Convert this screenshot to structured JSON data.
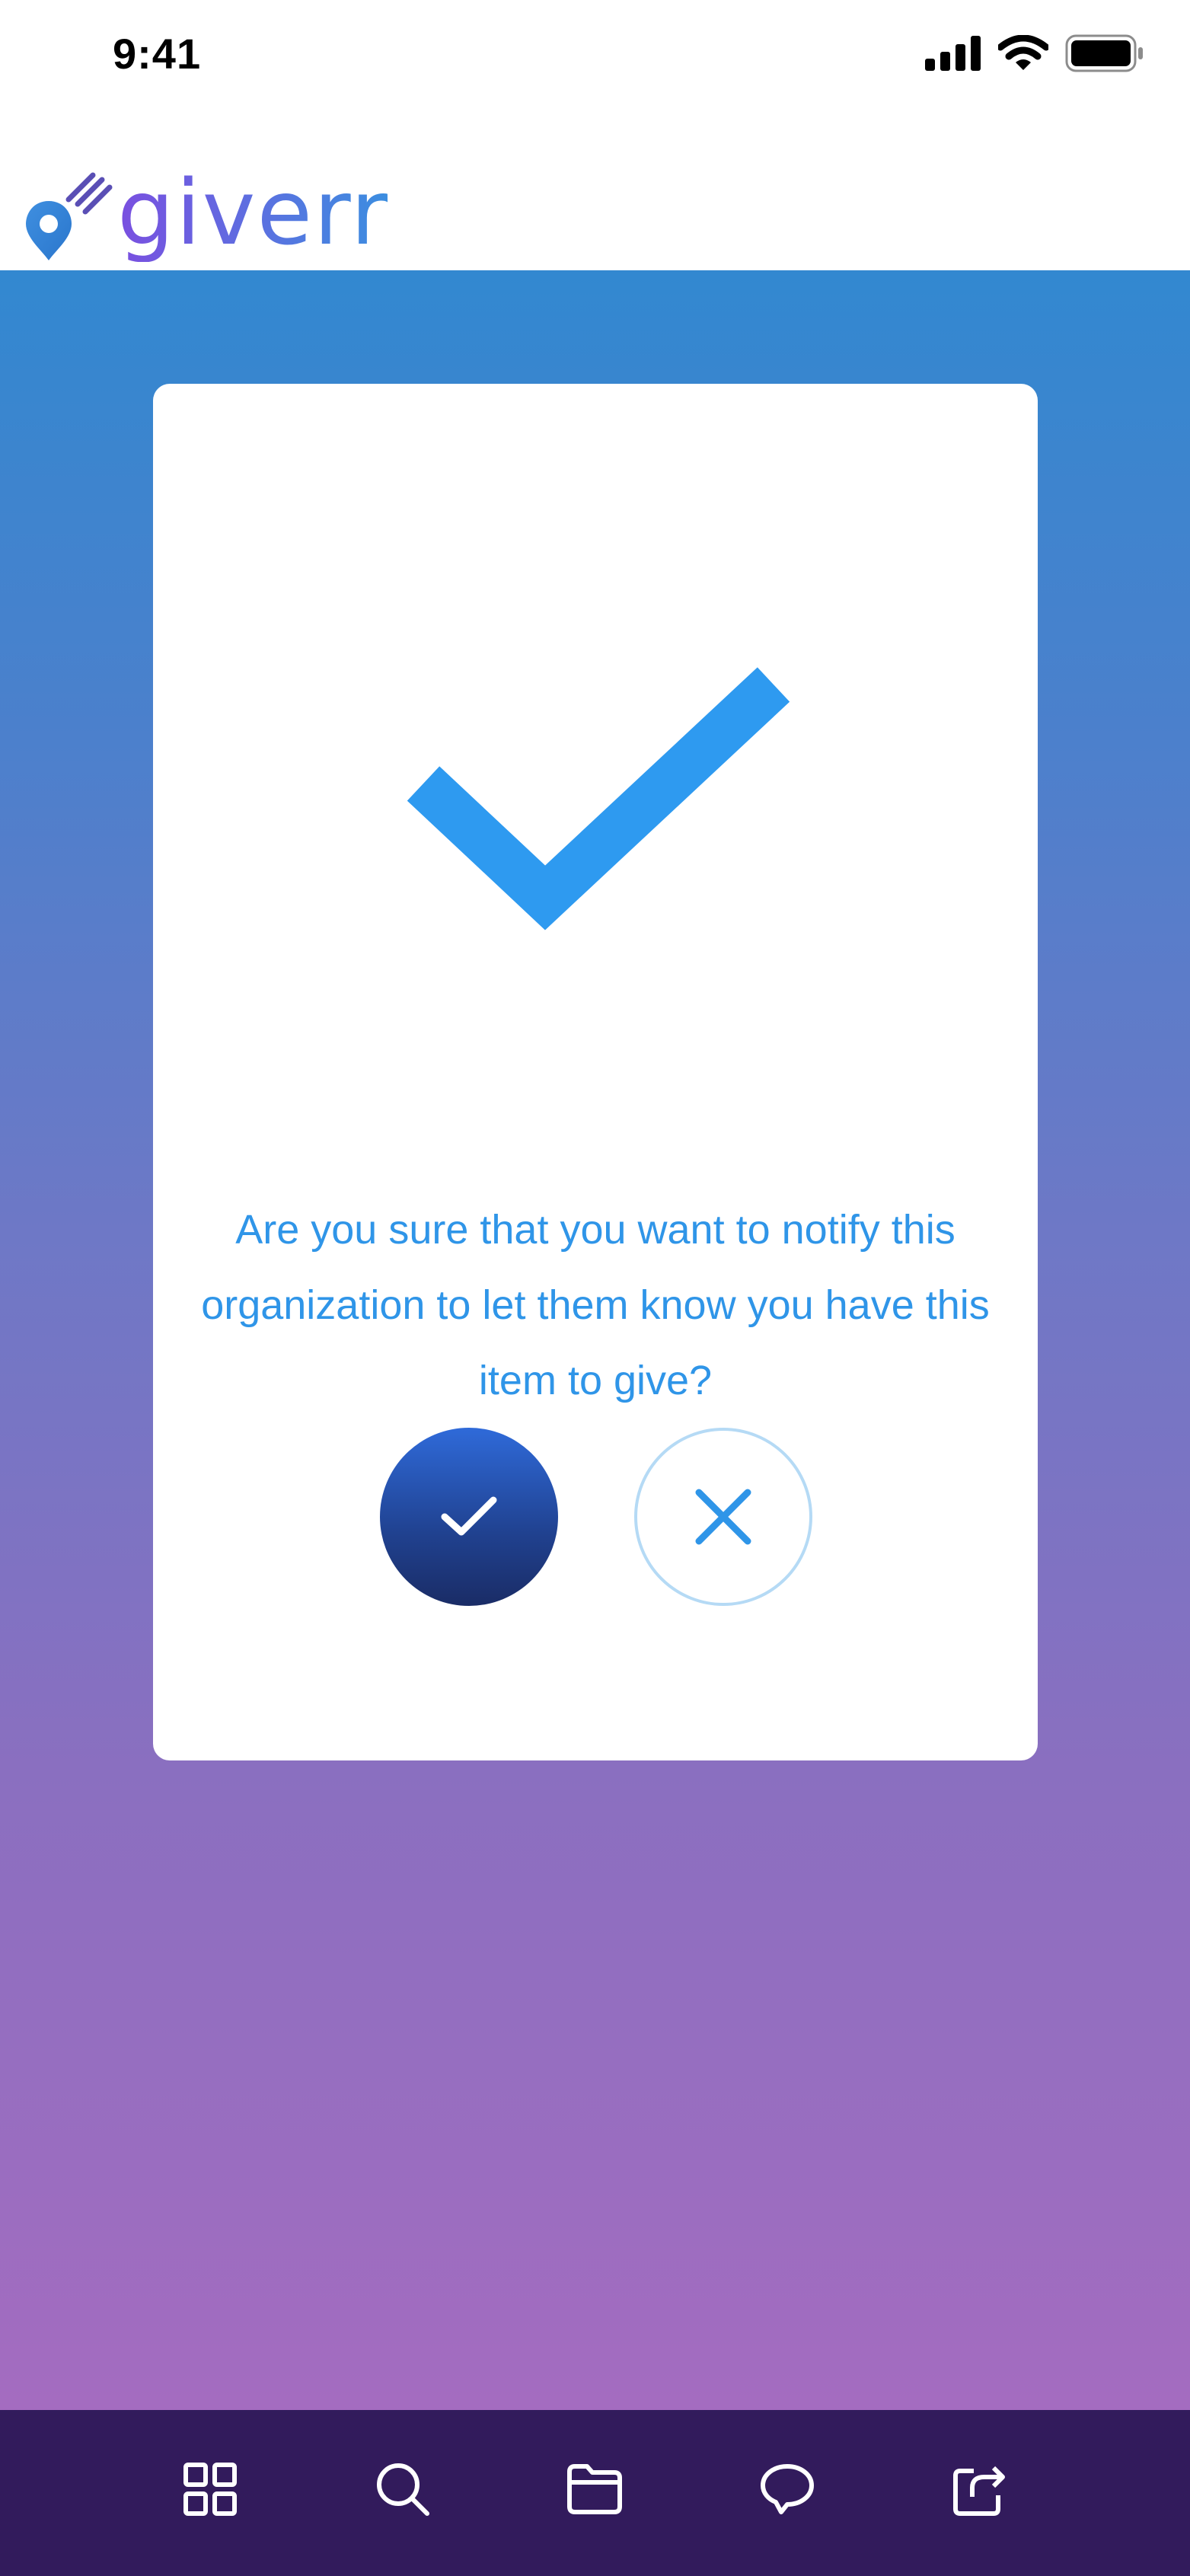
{
  "status_bar": {
    "time": "9:41",
    "icons": [
      "signal-icon",
      "wifi-icon",
      "battery-icon"
    ]
  },
  "app": {
    "logo_text": "giverr",
    "logo_icon": "location-pin-icon"
  },
  "dialog": {
    "hero_icon": "checkmark-icon",
    "message": "Are you sure that you want to notify this organization to let them know you have this item to give?",
    "confirm_icon": "check-icon",
    "cancel_icon": "close-icon"
  },
  "bottom_nav": {
    "items": [
      {
        "name": "home",
        "icon": "grid-icon"
      },
      {
        "name": "search",
        "icon": "search-icon"
      },
      {
        "name": "folder",
        "icon": "folder-icon"
      },
      {
        "name": "messages",
        "icon": "chat-bubble-icon"
      },
      {
        "name": "share",
        "icon": "share-icon"
      }
    ]
  },
  "colors": {
    "accent": "#2f95e8",
    "gradient_top": "#3288d0",
    "gradient_bottom": "#a46cc0",
    "nav_background": "#321b5c",
    "confirm_button": "#20418f"
  }
}
